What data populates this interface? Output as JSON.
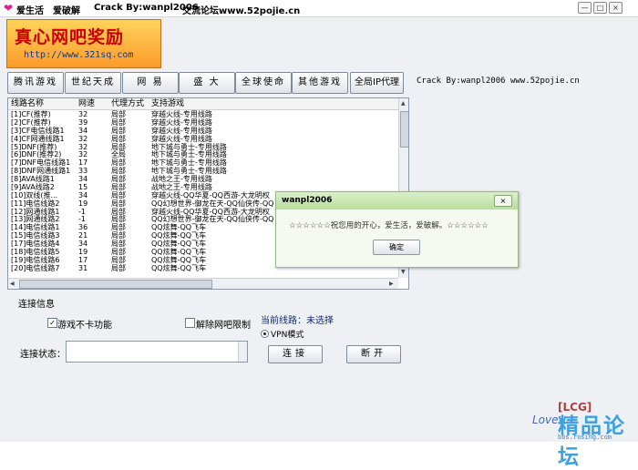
{
  "titlebar": {
    "items": [
      "爱生活",
      "爱破解",
      "Crack By:wanpl2006",
      "交流论坛www.52pojie.cn"
    ],
    "controls": [
      "—",
      "□",
      "×"
    ]
  },
  "banner": {
    "headline": "真心网吧奖励",
    "url": "http://www.321sq.com"
  },
  "game_buttons": [
    "腾讯游戏",
    "世纪天成",
    "网 易",
    "盛 大",
    "全球使命",
    "其他游戏",
    "全局IP代理"
  ],
  "credit": "Crack By:wanpl2006 www.52pojie.cn",
  "list": {
    "headers": [
      "线路名称",
      "网速",
      "代理方式",
      "支持游戏"
    ],
    "rows": [
      [
        "[1]CF(推荐)",
        "32",
        "局部",
        "穿越火线-专用线路"
      ],
      [
        "[2]CF(推荐)",
        "39",
        "局部",
        "穿越火线-专用线路"
      ],
      [
        "[3]CF电信线路1",
        "34",
        "局部",
        "穿越火线-专用线路"
      ],
      [
        "[4]CF网通线路1",
        "32",
        "局部",
        "穿越火线-专用线路"
      ],
      [
        "[5]DNF(推荐)",
        "32",
        "局部",
        "地下城与勇士-专用线路"
      ],
      [
        "[6]DNF(推荐2)",
        "32",
        "全局",
        "地下城与勇士-专用线路"
      ],
      [
        "[7]DNF电信线路1",
        "17",
        "局部",
        "地下城与勇士-专用线路"
      ],
      [
        "[8]DNF网通线路1",
        "33",
        "局部",
        "地下城与勇士-专用线路"
      ],
      [
        "[8]AVA线路1",
        "34",
        "局部",
        "战地之王-专用线路"
      ],
      [
        "[9]AVA线路2",
        "15",
        "局部",
        "战地之王-专用线路"
      ],
      [
        "[10]双线(推...",
        "34",
        "局部",
        "穿越火线-QQ华夏-QQ西游-大龙明权"
      ],
      [
        "[11]电信线路2",
        "19",
        "局部",
        "QQ幻想世界-御龙在天-QQ仙侠传-QQ"
      ],
      [
        "[12]网通线路1",
        "-1",
        "局部",
        "穿越火线-QQ华夏-QQ西游-大龙明权"
      ],
      [
        "[13]网通线路2",
        "-1",
        "局部",
        "QQ幻想世界-御龙在天-QQ仙侠传-QQ"
      ],
      [
        "[14]电信线路1",
        "36",
        "局部",
        "QQ炫舞-QQ飞车"
      ],
      [
        "[15]电信线路3",
        "21",
        "局部",
        "QQ炫舞-QQ飞车"
      ],
      [
        "[17]电信线路4",
        "34",
        "局部",
        "QQ炫舞-QQ飞车"
      ],
      [
        "[18]电信线路5",
        "19",
        "局部",
        "QQ炫舞-QQ飞车"
      ],
      [
        "[19]电信线路6",
        "17",
        "局部",
        "QQ炫舞-QQ飞车"
      ],
      [
        "[20]电信线路7",
        "31",
        "局部",
        "QQ炫舞-QQ飞车"
      ]
    ]
  },
  "connection": {
    "group_title": "连接信息",
    "no_lag_label": "游戏不卡功能",
    "no_lag_checked": true,
    "remove_limit_label": "解除网吧限制",
    "remove_limit_checked": false,
    "current_line_label": "当前线路：未选择",
    "vpn_label": "VPN模式",
    "status_label": "连接状态：",
    "connect_button": "连接",
    "disconnect_button": "断开"
  },
  "dialog": {
    "title": "wanpl2006",
    "message": "☆☆☆☆☆☆祝您用的开心，爱生活，爱破解。☆☆☆☆☆☆",
    "ok_button": "确定",
    "close": "×"
  },
  "watermark": {
    "tag": "[LCG]",
    "love": "Love",
    "logo": "精品论坛",
    "site": "bbs.rosing.com"
  },
  "colors": {
    "window_bg": "#eef0f3",
    "dialog_title": "#b8dda0",
    "banner_text": "#c80000",
    "watermark": "#3fa0e0"
  }
}
